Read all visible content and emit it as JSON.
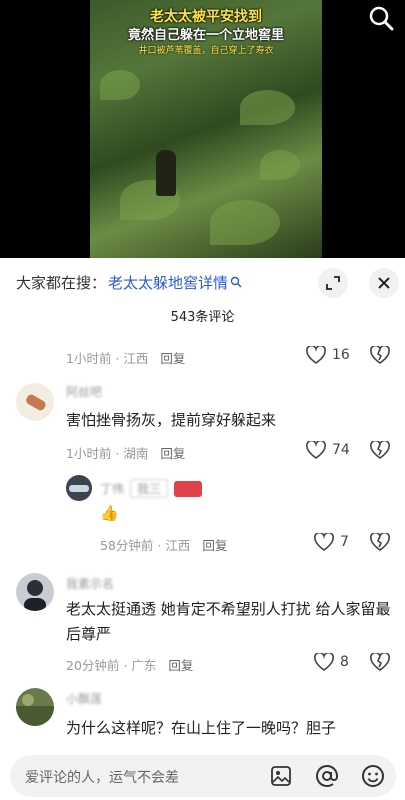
{
  "video": {
    "caption_line1": "老太太被平安找到",
    "caption_line2": "竟然自己躲在一个立地窖里",
    "caption_line3": "井口被芦苇覆盖，自己穿上了寿衣"
  },
  "panel": {
    "hot_search_prefix": "大家都在搜：",
    "hot_search_keyword": "老太太躲地窖详情",
    "comment_count": "543条评论"
  },
  "comments": [
    {
      "meta_time": "1小时前",
      "meta_loc": "江西",
      "reply_label": "回复",
      "likes": "16"
    },
    {
      "username": "阿丝吧",
      "text": "害怕挫骨扬灰，提前穿好躲起来",
      "meta_time": "1小时前",
      "meta_loc": "湖南",
      "reply_label": "回复",
      "likes": "74"
    },
    {
      "username": "丁伟",
      "badge": "我三",
      "text": "👍",
      "meta_time": "58分钟前",
      "meta_loc": "江西",
      "reply_label": "回复",
      "likes": "7"
    },
    {
      "username": "我素示名",
      "text": "老太太挺通透 她肯定不希望别人打扰 给人家留最后尊严",
      "meta_time": "20分钟前",
      "meta_loc": "广东",
      "reply_label": "回复",
      "likes": "8"
    },
    {
      "username": "小飘莲",
      "text": "为什么这样呢？在山上住了一晚吗？胆子"
    }
  ],
  "input_bar": {
    "placeholder": "爱评论的人，运气不会差"
  },
  "colors": {
    "accent_link": "#2a5bd7",
    "caption_yellow": "#ffe24a"
  }
}
